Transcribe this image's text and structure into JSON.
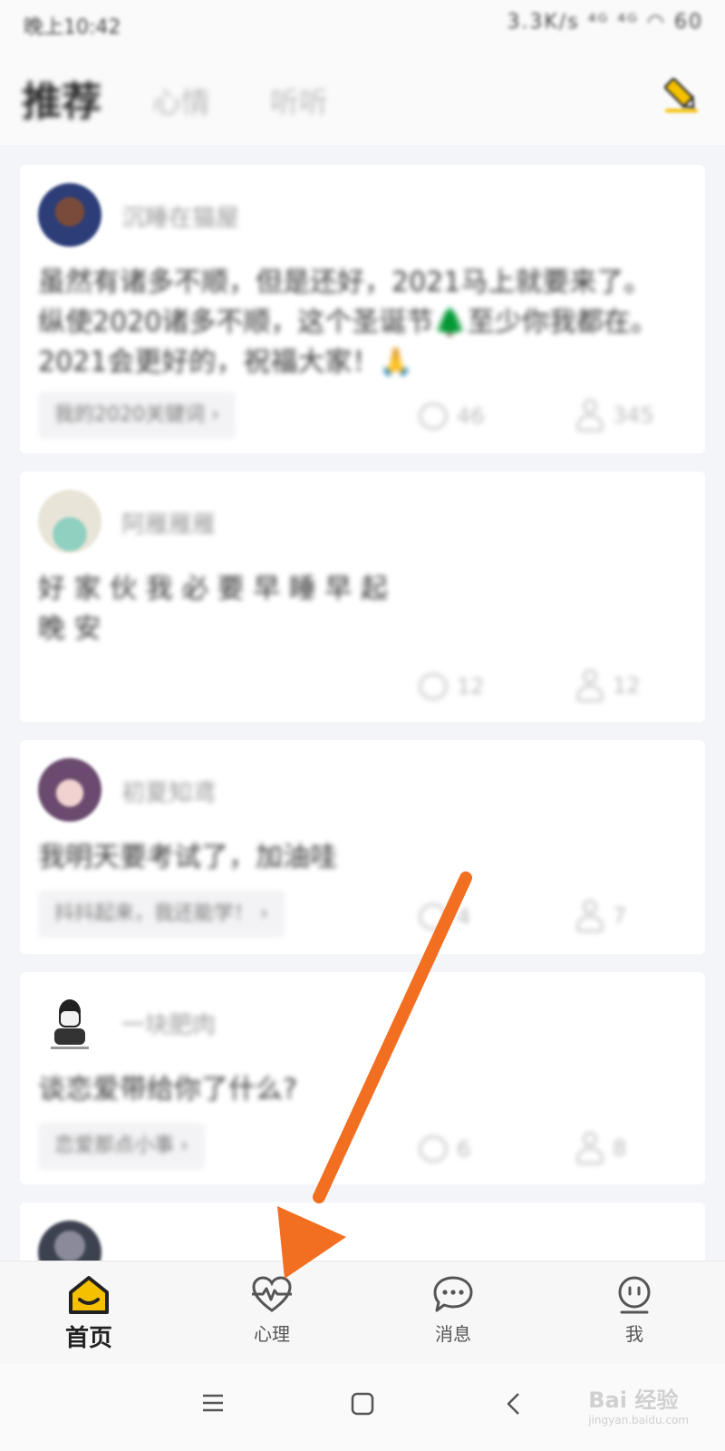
{
  "status_bar": {
    "time": "晚上10:42",
    "icons": "3.3K/s ⁴ᴳ ⁴ᴳ ◠ 60"
  },
  "header": {
    "tabs": [
      {
        "label": "推荐",
        "active": true
      },
      {
        "label": "心情",
        "active": false
      },
      {
        "label": "听听",
        "active": false
      }
    ],
    "compose_icon": "pencil-icon"
  },
  "feed": {
    "posts": [
      {
        "username": "沉睡在猫屋",
        "text_lines": [
          "虽然有诸多不顺，但是还好，2021马上就要来了。",
          "纵使2020诸多不顺，这个圣诞节🌲至少你我都在。",
          "2021会更好的，祝福大家！🙏"
        ],
        "topic": "我的2020关键词 ›",
        "comments": "46",
        "hugs": "345"
      },
      {
        "username": "阿雁雁雁",
        "text_lines": [
          "好 家 伙 我 必 要 早 睡 早 起",
          "晚 安"
        ],
        "topic": "",
        "comments": "12",
        "hugs": "12"
      },
      {
        "username": "初夏知鸢",
        "text_lines": [
          "我明天要考试了，加油哇"
        ],
        "topic": "抖抖起来，我还能学！ ›",
        "comments": "4",
        "hugs": "7"
      },
      {
        "username": "一块肥肉",
        "text_lines": [
          "谈恋爱带给你了什么?"
        ],
        "topic": "恋爱那点小事 ›",
        "comments": "6",
        "hugs": "8"
      }
    ]
  },
  "bottom_nav": {
    "items": [
      {
        "label": "首页",
        "icon": "home-icon",
        "active": true
      },
      {
        "label": "心理",
        "icon": "heart-pulse-icon",
        "active": false
      },
      {
        "label": "消息",
        "icon": "chat-bubble-icon",
        "active": false
      },
      {
        "label": "我",
        "icon": "face-icon",
        "active": false
      }
    ]
  },
  "system_nav": {
    "icons": [
      "menu-icon",
      "home-square-icon",
      "back-icon"
    ]
  },
  "watermark": {
    "text": "Bai 经验",
    "url_text": "jingyan.baidu.com"
  },
  "colors": {
    "accent": "#f4c000",
    "annotation_arrow": "#f26f21"
  }
}
